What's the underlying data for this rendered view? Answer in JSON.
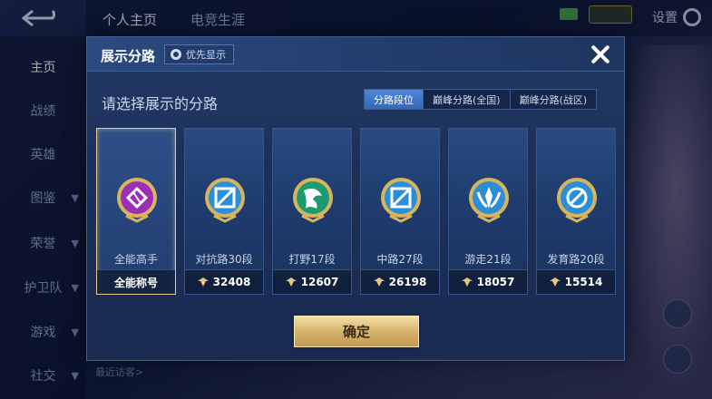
{
  "top_tabs": [
    {
      "label": "个人主页"
    },
    {
      "label": "电竞生涯"
    }
  ],
  "settings_label": "设置",
  "side_nav": [
    {
      "label": "主页"
    },
    {
      "label": "战绩"
    },
    {
      "label": "英雄"
    },
    {
      "label": "图鉴"
    },
    {
      "label": "荣誉"
    },
    {
      "label": "护卫队"
    },
    {
      "label": "游戏"
    },
    {
      "label": "社交"
    }
  ],
  "bottom_visitors": "最近访客>",
  "modal": {
    "title": "展示分路",
    "priority_label": "优先显示",
    "prompt": "请选择展示的分路",
    "tabs": [
      {
        "label": "分路段位",
        "active": true
      },
      {
        "label": "巅峰分路(全国)",
        "active": false
      },
      {
        "label": "巅峰分路(战区)",
        "active": false
      }
    ],
    "cards": [
      {
        "name": "全能高手",
        "footer": "全能称号",
        "icon": "all-round-emblem-icon",
        "selected": true,
        "color": "#b43ec8"
      },
      {
        "name": "对抗路30段",
        "footer": "32408",
        "icon": "clash-lane-emblem-icon",
        "selected": false,
        "color": "#3aa7e8"
      },
      {
        "name": "打野17段",
        "footer": "12607",
        "icon": "jungle-emblem-icon",
        "selected": false,
        "color": "#2fae7e"
      },
      {
        "name": "中路27段",
        "footer": "26198",
        "icon": "mid-lane-emblem-icon",
        "selected": false,
        "color": "#3aa7e8"
      },
      {
        "name": "游走21段",
        "footer": "18057",
        "icon": "roam-emblem-icon",
        "selected": false,
        "color": "#3aa7e8"
      },
      {
        "name": "发育路20段",
        "footer": "15514",
        "icon": "farm-lane-emblem-icon",
        "selected": false,
        "color": "#3aa7e8"
      }
    ],
    "confirm_label": "确定"
  }
}
